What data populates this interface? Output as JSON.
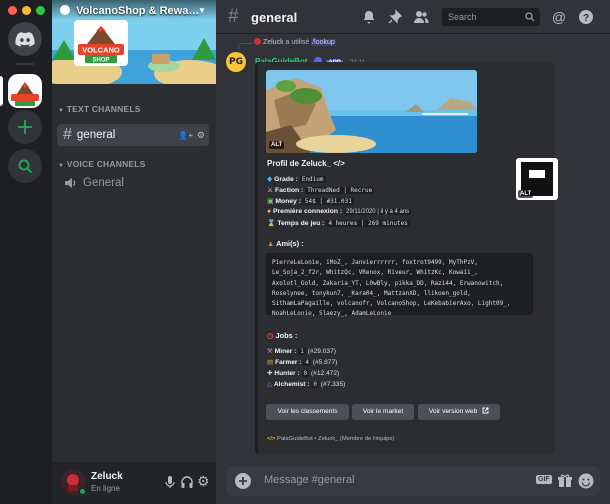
{
  "server": {
    "name": "VolcanoShop & Rewa…",
    "banner_text": "VOLCANO\nSHOP"
  },
  "sidebar": {
    "text_category": "TEXT CHANNELS",
    "voice_category": "VOICE CHANNELS",
    "text_channels": [
      {
        "label": "general"
      }
    ],
    "voice_channels": [
      {
        "label": "General"
      }
    ]
  },
  "user": {
    "name": "Zeluck",
    "status": "En ligne"
  },
  "header": {
    "channel": "general",
    "search_placeholder": "Search"
  },
  "message": {
    "reply_user": "Zeluck",
    "reply_action": "a utilisé",
    "reply_command": "/lookup",
    "author": "PalaGuideBot",
    "app_badge": "APP",
    "timestamp": "21:11",
    "embed": {
      "alt1": "ALT",
      "alt2": "ALT",
      "profile_title": "Profil de Zeluck_ </>",
      "stats": [
        {
          "label": "Grade :",
          "value": "Endium"
        },
        {
          "label": "Faction :",
          "value": "ThreadNed | Recrue"
        },
        {
          "label": "Money :",
          "value": "54$ | #31.031"
        },
        {
          "label": "Première connexion :",
          "value": "29/11/2020 | il y a 4 ans"
        },
        {
          "label": "Temps de jeu :",
          "value": "4 heures | 269 minutes"
        }
      ],
      "friends_title": "Ami(s) :",
      "friends_text": "PierreLeLonie, iMoZ_, Janvierrrrrr, foxtrot9499, MyThPzV, Le_Soja_2_f2r, WhitzQc, VRenox, Riveur, WhitzKc, Kowaii_, Axolotl_Gold, Zakaria_YT, L0wBly, pikka_DD, Razi44, Erwanowitch, Roselynee, tonykun7, _Kara04_, MattzanXD, llikoen_gold, SithamLaPagaille, volcanofr, VolcanoShop, LeKebabierAxo, Light09_, NoahLeLonie, Slaezy_, AdamLeLonie",
      "jobs_title": "Jobs :",
      "jobs": [
        {
          "label": "Miner :",
          "value": "1",
          "rank": "(#29.037)"
        },
        {
          "label": "Farmer :",
          "value": "4",
          "rank": "(#5.877)"
        },
        {
          "label": "Hunter :",
          "value": "0",
          "rank": "(#12.472)"
        },
        {
          "label": "Alchemist :",
          "value": "0",
          "rank": "(#7.335)"
        }
      ],
      "buttons": [
        "Voir les classements",
        "Voir le market",
        "Voir version web"
      ],
      "footer": "PalaGuideBot • Zeluck_ (Membre de l'équipe)"
    }
  },
  "composer": {
    "placeholder": "Message #general"
  },
  "colors": {
    "blurple": "#5865f2",
    "green": "#23a559",
    "server_rail": "#1e1f22",
    "sidebar": "#2b2d31",
    "chat": "#313338"
  },
  "icons": [
    "discord-icon",
    "add-server-icon",
    "explore-icon",
    "hash-icon",
    "speaker-icon",
    "bell-icon",
    "pin-icon",
    "members-icon",
    "search-icon",
    "at-icon",
    "help-icon",
    "mic-icon",
    "headphones-icon",
    "gear-icon",
    "plus-icon",
    "gif-icon",
    "gift-icon",
    "emoji-icon"
  ]
}
